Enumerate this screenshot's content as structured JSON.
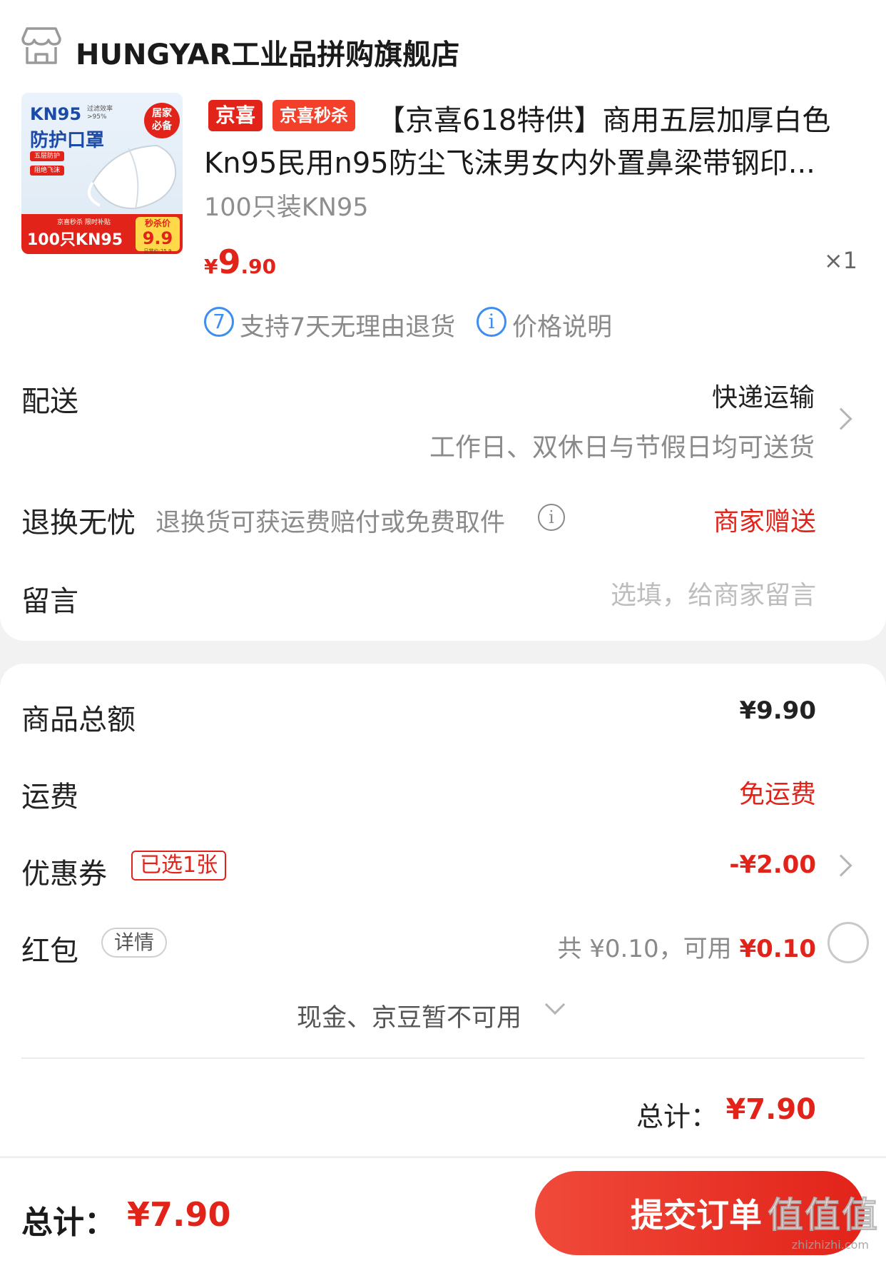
{
  "shop": {
    "name": "HUNGYAR工业品拼购旗舰店",
    "icon": "store-icon"
  },
  "product": {
    "image": {
      "kn95": "KN95",
      "title": "防护口罩",
      "tagline_1": "过滤效率",
      "tagline_2": ">95%",
      "chip_1": "五层防护",
      "chip_2": "阻绝飞沫",
      "badge_1": "居家",
      "badge_2": "必备",
      "bar_top": "京喜秒杀 限时补贴",
      "bar_main": "100只KN95",
      "price_yen": "¥",
      "price_label": "秒杀价",
      "price_num": "9.9",
      "price_note": "日常价:25.9"
    },
    "tags": [
      "京喜",
      "京喜秒杀"
    ],
    "title_line1": "【京喜618特供】商用五层加厚白色",
    "title_line2": "Kn95民用n95防尘飞沫男女内外置鼻梁带钢印...",
    "spec": "100只装KN95",
    "price_yen": "¥",
    "price_int": "9",
    "price_dec": ".90",
    "quantity": "×1",
    "services": [
      {
        "icon": "7",
        "text": "支持7天无理由退货"
      },
      {
        "icon": "i",
        "text": "价格说明"
      }
    ]
  },
  "delivery": {
    "label": "配送",
    "method": "快递运输",
    "note": "工作日、双休日与节假日均可送货"
  },
  "returns": {
    "label": "退换无忧",
    "desc": "退换货可获运费赔付或免费取件",
    "info_icon": "i",
    "value": "商家赠送"
  },
  "note": {
    "label": "留言",
    "placeholder": "选填，给商家留言"
  },
  "summary": {
    "goods_label": "商品总额",
    "goods_value": "¥9.90",
    "shipping_label": "运费",
    "shipping_value": "免运费",
    "coupon_label": "优惠券",
    "coupon_badge": "已选1张",
    "coupon_value": "-¥2.00",
    "redpacket_label": "红包",
    "redpacket_detail": "详情",
    "redpacket_total": "共 ¥0.10，可用",
    "redpacket_available": "¥0.10",
    "cash_note": "现金、京豆暂不可用",
    "subtotal_label": "总计：",
    "subtotal_value": "¥7.90"
  },
  "bottom": {
    "total_label": "总计：",
    "total_value": "¥7.90",
    "submit_label": "提交订单"
  },
  "watermark": {
    "text": "值值值",
    "url": "zhizhizhi.com"
  },
  "colors": {
    "accent_red": "#e2231a",
    "info_blue": "#3d8ef0",
    "background": "#f2f2f2"
  }
}
